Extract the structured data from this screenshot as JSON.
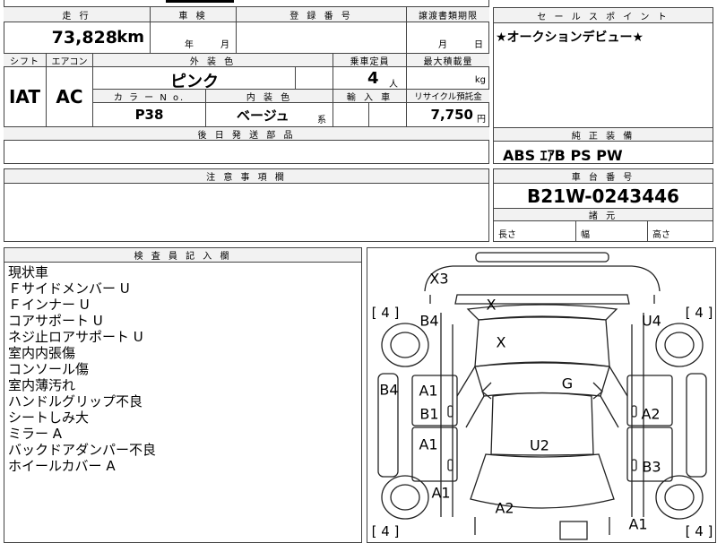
{
  "top_sheet": {
    "h_mileage": "走 行",
    "h_inspection": "車 検",
    "h_reg_no": "登 録 番 号",
    "h_transfer": "譲渡書類期限",
    "mileage_value": "73,828",
    "mileage_unit": "km",
    "insp_year": "年",
    "insp_month": "月",
    "transfer_month": "月",
    "transfer_day": "日",
    "h_shift": "シフト",
    "h_aircon": "エアコン",
    "h_ext_color": "外 装 色",
    "h_capacity": "乗車定員",
    "h_max_load": "最大積載量",
    "shift_value": "IAT",
    "aircon_value": "AC",
    "ext_color_value": "ピンク",
    "capacity_value": "4",
    "capacity_unit": "人",
    "max_load_unit": "kg",
    "h_color_no": "カ ラ ー N o.",
    "h_int_color": "内 装 色",
    "h_import": "輸 入 車",
    "h_recycle": "リサイクル預託金",
    "color_no_value": "P38",
    "int_color_value": "ベージュ",
    "int_color_suffix": "系",
    "recycle_value": "7,750",
    "recycle_unit": "円",
    "h_after_parts": "後 日 発 送 部 品"
  },
  "sales_point": {
    "header": "セ ー ル ス ポ イ ン ト",
    "text": "★オークションデビュー★"
  },
  "equipment": {
    "header": "純 正 装 備",
    "text": "ABS ｴｱB PS PW"
  },
  "notes": {
    "header": "注 意 事 項 欄"
  },
  "chassis": {
    "header": "車 台 番 号",
    "value": "B21W-0243446"
  },
  "dimensions": {
    "header": "諸 元",
    "length": "長さ",
    "width": "幅",
    "height": "高さ"
  },
  "inspector": {
    "header": "検 査 員 記 入 欄",
    "lines": [
      "現状車",
      "Ｆサイドメンバー U",
      "Ｆインナー U",
      "コアサポート U",
      "ネジ止ロアサポート U",
      "室内内張傷",
      "コンソール傷",
      "室内薄汚れ",
      "ハンドルグリップ不良",
      "シートしみ大",
      "ミラー A",
      "バックドアダンパー不良",
      "ホイールカバー A"
    ]
  },
  "diagram": {
    "marks": {
      "rear_x3": "X3",
      "upper_x": "X",
      "roof_x": "X",
      "b4_top": "B4",
      "u4": "U4",
      "g": "G",
      "b4_side": "B4",
      "a1_door1": "A1",
      "b1": "B1",
      "a2_right": "A2",
      "a1_door2": "A1",
      "u2": "U2",
      "b3": "B3",
      "a1_front": "A1",
      "a2_hood": "A2",
      "a1_front_right": "A1"
    },
    "tires": {
      "rear_left": "[ 4 ]",
      "rear_right": "[ 4 ]",
      "front_left": "[ 4 ]",
      "front_right": "[ 4 ]"
    }
  }
}
